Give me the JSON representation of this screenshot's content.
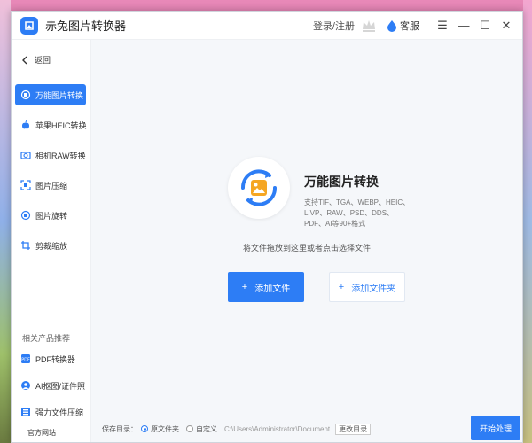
{
  "colors": {
    "accent": "#2d7df5",
    "sidebar_bg": "#ffffff",
    "main_bg": "#f5f7fa",
    "gold": "#c8a13a"
  },
  "titlebar": {
    "title": "赤兔图片转换器",
    "login_label": "登录/注册",
    "service_label": "客服",
    "menu_glyph": "☰",
    "minimize_glyph": "—",
    "maximize_glyph": "☐",
    "close_glyph": "✕",
    "icons": [
      "app-logo-icon",
      "vip-crown-icon",
      "service-drop-icon"
    ]
  },
  "sidebar": {
    "back_label": "返回",
    "items": [
      {
        "label": "万能图片转换",
        "icon": "universal-convert-icon",
        "active": true
      },
      {
        "label": "苹果HEIC转换",
        "icon": "apple-icon",
        "active": false
      },
      {
        "label": "相机RAW转换",
        "icon": "camera-icon",
        "active": false
      },
      {
        "label": "图片压缩",
        "icon": "compress-icon",
        "active": false
      },
      {
        "label": "图片旋转",
        "icon": "rotate-icon",
        "active": false
      },
      {
        "label": "剪裁缩放",
        "icon": "crop-icon",
        "active": false
      }
    ],
    "related_title": "相关产品推荐",
    "related": [
      {
        "label": "PDF转换器",
        "icon": "pdf-icon"
      },
      {
        "label": "AI抠图/证件照",
        "icon": "ai-matting-icon"
      },
      {
        "label": "强力文件压缩",
        "icon": "file-compress-icon"
      }
    ],
    "site_link": "官方网站"
  },
  "main": {
    "title": "万能图片转换",
    "description": "支持TIF、TGA、WEBP、HEIC、LIVP、RAW、PSD、DDS、PDF、AI等90+格式",
    "drop_hint": "将文件拖放到这里或者点击选择文件",
    "add_file_label": "添加文件",
    "add_folder_label": "添加文件夹",
    "plus_glyph": "+"
  },
  "save": {
    "label": "保存目录：",
    "option_original": "原文件夹",
    "option_custom": "自定义",
    "selected": "原文件夹",
    "path": "C:\\Users\\Administrator\\Document",
    "change_label": "更改目录"
  },
  "start_label": "开始处理"
}
